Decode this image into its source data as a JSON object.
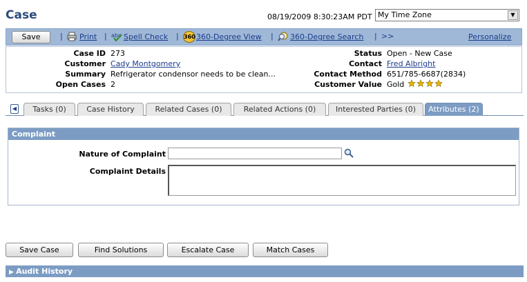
{
  "page_title": "Case",
  "datetime": "08/19/2009 8:30:23AM PDT",
  "timezone_select": "My Time Zone",
  "toolbar": {
    "save": "Save",
    "print": "Print",
    "spell_check": "Spell Check",
    "view360": "360-Degree View",
    "search360": "360-Degree Search",
    "more": ">>",
    "personalize": "Personalize",
    "badge360": "360"
  },
  "case_info": {
    "case_id_label": "Case ID",
    "case_id": "273",
    "customer_label": "Customer",
    "customer": "Cady Montgomery",
    "summary_label": "Summary",
    "summary": "Refrigerator condensor needs to be clean...",
    "open_cases_label": "Open Cases",
    "open_cases": "2",
    "status_label": "Status",
    "status": "Open - New Case",
    "contact_label": "Contact",
    "contact": "Fred Albright",
    "contact_method_label": "Contact Method",
    "contact_method": "651/785-6687(2834)",
    "customer_value_label": "Customer Value",
    "customer_value": "Gold",
    "customer_value_stars": 4,
    "star_color": "#e8b800"
  },
  "tabs": [
    {
      "label": "Tasks (0)"
    },
    {
      "label": "Case History"
    },
    {
      "label": "Related Cases (0)"
    },
    {
      "label": "Related Actions (0)"
    },
    {
      "label": "Interested Parties (0)"
    },
    {
      "label": "Attributes (2)"
    }
  ],
  "complaint": {
    "header": "Complaint",
    "nature_label": "Nature of Complaint",
    "nature_value": "",
    "details_label": "Complaint Details",
    "details_value": ""
  },
  "actions": {
    "save_case": "Save Case",
    "find_solutions": "Find Solutions",
    "escalate_case": "Escalate Case",
    "match_cases": "Match Cases"
  },
  "audit_history": "Audit History",
  "colors": {
    "header_blue": "#7c9cc4",
    "title_blue": "#2b4d7c",
    "link_blue": "#1a3b8c"
  }
}
